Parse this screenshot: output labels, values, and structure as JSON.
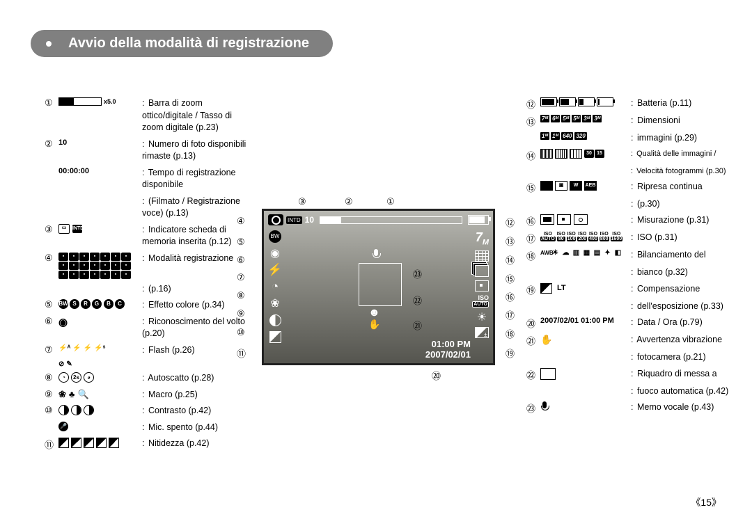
{
  "title": "Avvio della modalità di registrazione",
  "page_number": "《15》",
  "lcd": {
    "count": "10",
    "intd": "INTD",
    "size": "7",
    "size_m": "M",
    "iso_label": "ISO",
    "iso_mode": "AUTO",
    "time": "01:00 PM",
    "date": "2007/02/01"
  },
  "left": [
    {
      "n": "①",
      "label_type": "zoombar",
      "label_suffix": "x5.0",
      "desc": "Barra di zoom ottico/digitale / Tasso di zoom digitale (p.23)"
    },
    {
      "n": "②",
      "label_text": "10",
      "desc": "Numero di foto disponibili rimaste (p.13)"
    },
    {
      "n": "",
      "label_text": "00:00:00",
      "desc": "Tempo di registrazione disponibile"
    },
    {
      "n": "",
      "label_text": "",
      "desc": "(Filmato / Registrazione voce) (p.13)"
    },
    {
      "n": "③",
      "label_type": "memcard",
      "desc": "Indicatore scheda di memoria inserita  (p.12)"
    },
    {
      "n": "④",
      "label_type": "modegrid",
      "desc": "Modalità registrazione"
    },
    {
      "n": "",
      "label_text": "",
      "desc": "(p.16)"
    },
    {
      "n": "⑤",
      "label_type": "fx",
      "desc": "Effetto colore (p.34)"
    },
    {
      "n": "⑥",
      "label_type": "face",
      "desc": "Riconoscimento del volto (p.20)"
    },
    {
      "n": "⑦",
      "label_type": "flash",
      "desc": "Flash (p.26)"
    },
    {
      "n": "",
      "label_type": "flash2",
      "desc": ""
    },
    {
      "n": "⑧",
      "label_type": "self",
      "desc": "Autoscatto (p.28)"
    },
    {
      "n": "⑨",
      "label_type": "macro",
      "desc": "Macro (p.25)"
    },
    {
      "n": "⑩",
      "label_type": "contrast",
      "desc": "Contrasto (p.42)"
    },
    {
      "n": "",
      "label_type": "micoff",
      "desc": "Mic. spento (p.44)"
    },
    {
      "n": "⑪",
      "label_type": "sharp",
      "desc": "Nitidezza (p.42)"
    }
  ],
  "right": [
    {
      "n": "⑫",
      "label_type": "battery",
      "desc": "Batteria (p.11)"
    },
    {
      "n": "⑬",
      "label_type": "dims",
      "desc": "Dimensioni"
    },
    {
      "n": "",
      "label_type": "dims2",
      "desc": "immagini (p.29)"
    },
    {
      "n": "⑭",
      "label_type": "quality",
      "desc": "Qualità delle immagini /",
      "small": true
    },
    {
      "n": "",
      "label_text": "",
      "desc": "Velocità fotogrammi (p.30)",
      "small": true
    },
    {
      "n": "⑮",
      "label_type": "drive",
      "desc": "Ripresa continua"
    },
    {
      "n": "",
      "label_text": "",
      "desc": "(p.30)"
    },
    {
      "n": "⑯",
      "label_type": "meter",
      "desc": "Misurazione (p.31)"
    },
    {
      "n": "⑰",
      "label_type": "iso",
      "desc": "ISO (p.31)"
    },
    {
      "n": "⑱",
      "label_type": "wb",
      "desc": "Bilanciamento del"
    },
    {
      "n": "",
      "label_text": "",
      "desc": "bianco (p.32)"
    },
    {
      "n": "⑲",
      "label_type": "expo",
      "label_text": "LT",
      "desc": "Compensazione"
    },
    {
      "n": "",
      "label_text": "",
      "desc": "dell'esposizione (p.33)"
    },
    {
      "n": "⑳",
      "label_text": "2007/02/01 01:00 PM",
      "bold": true,
      "desc": "Data / Ora (p.79)"
    },
    {
      "n": "㉑",
      "label_type": "shake",
      "desc": "Avvertenza vibrazione"
    },
    {
      "n": "",
      "label_text": "",
      "desc": "fotocamera (p.21)"
    },
    {
      "n": "㉒",
      "label_type": "afbox",
      "desc": "Riquadro di messa a"
    },
    {
      "n": "",
      "label_text": "",
      "desc": "fuoco automatica (p.42)"
    },
    {
      "n": "㉓",
      "label_type": "mic",
      "desc": "Memo vocale (p.43)"
    }
  ],
  "callouts_top": {
    "c3": "③",
    "c2": "②",
    "c1": "①"
  },
  "callouts_left": {
    "c4": "④",
    "c5": "⑤",
    "c6": "⑥",
    "c7": "⑦",
    "c8": "⑧",
    "c9": "⑨",
    "c10": "⑩",
    "c11": "⑪"
  },
  "callouts_right": {
    "c12": "⑫",
    "c13": "⑬",
    "c14": "⑭",
    "c15": "⑮",
    "c16": "⑯",
    "c17": "⑰",
    "c18": "⑱",
    "c19": "⑲"
  },
  "callouts_bottom": {
    "c20": "⑳",
    "c21": "㉑",
    "c22": "㉒",
    "c23": "㉓"
  }
}
